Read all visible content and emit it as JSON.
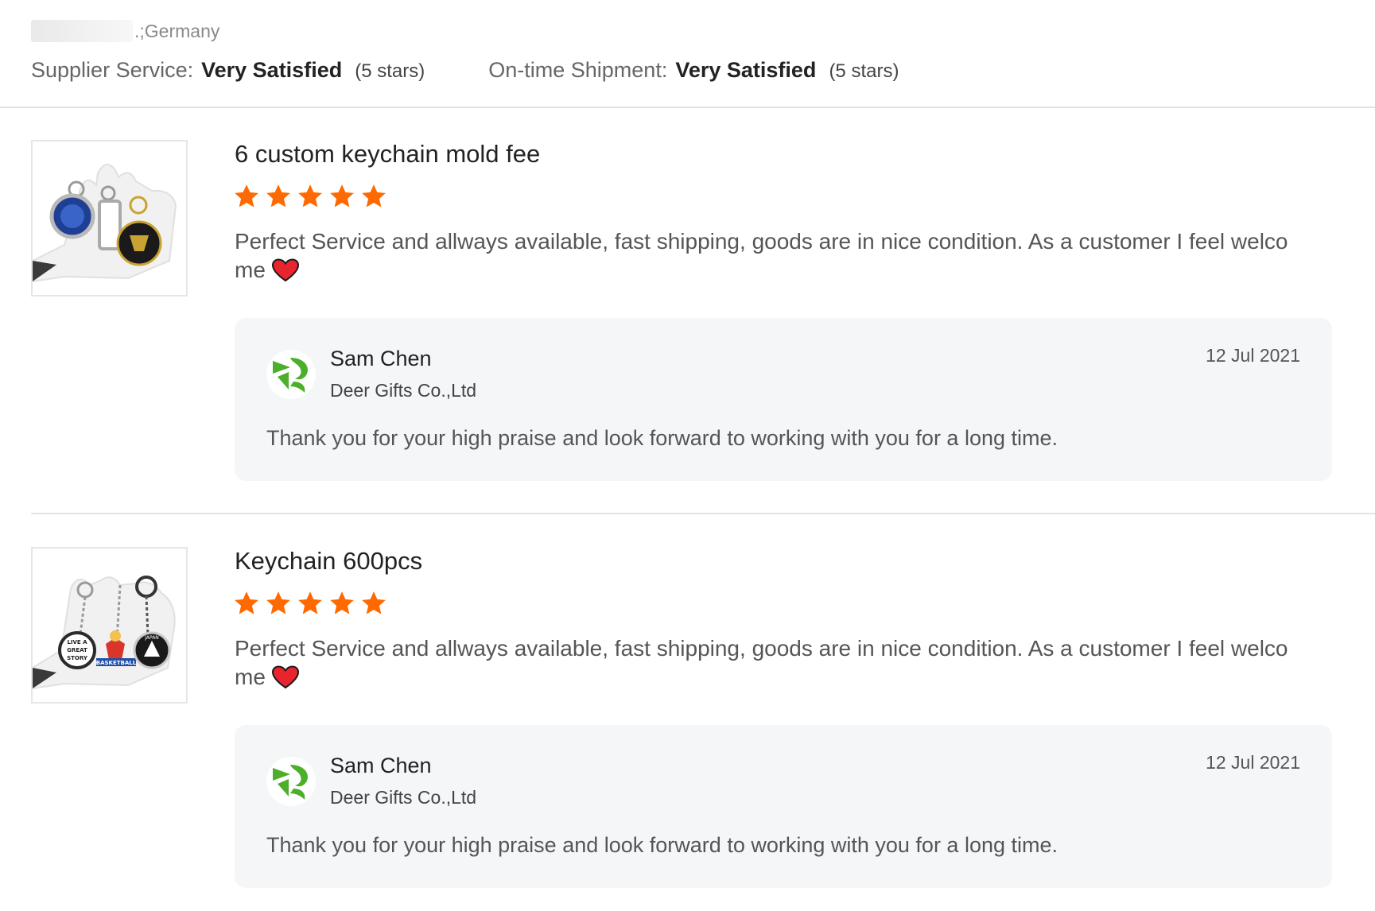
{
  "reviewer": {
    "location_suffix": ".;Germany"
  },
  "ratings": {
    "supplier_service": {
      "label": "Supplier Service:",
      "value": "Very Satisfied",
      "stars": "(5 stars)"
    },
    "shipment": {
      "label": "On-time Shipment:",
      "value": "Very Satisfied",
      "stars": "(5 stars)"
    }
  },
  "reviews": [
    {
      "title": "6 custom keychain mold fee",
      "rating": 5,
      "comment": "Perfect Service and allways available, fast shipping, goods are in nice condition. As a customer I feel welco me",
      "thumbnail_icon": "keychain-product-photo",
      "reply": {
        "name": "Sam Chen",
        "company": "Deer Gifts Co.,Ltd",
        "date": "12 Jul 2021",
        "text": "Thank you for your high praise and look forward to working with you for a long time."
      }
    },
    {
      "title": "Keychain 600pcs",
      "rating": 5,
      "comment": "Perfect Service and allways available, fast shipping, goods are in nice condition. As a customer I feel welco me",
      "thumbnail_icon": "keychain-product-photo",
      "thumbnail_badges": [
        "LIVE A",
        "GREAT",
        "STORY",
        "BASKETBALL",
        "JAPAN"
      ],
      "reply": {
        "name": "Sam Chen",
        "company": "Deer Gifts Co.,Ltd",
        "date": "12 Jul 2021",
        "text": "Thank you for your high praise and look forward to working with you for a long time."
      }
    }
  ],
  "colors": {
    "star": "#ff6a00",
    "heart": "#e8252e",
    "logo_green": "#4caf2a",
    "reply_background": "#f5f6f8",
    "divider": "#e2e2e2"
  }
}
